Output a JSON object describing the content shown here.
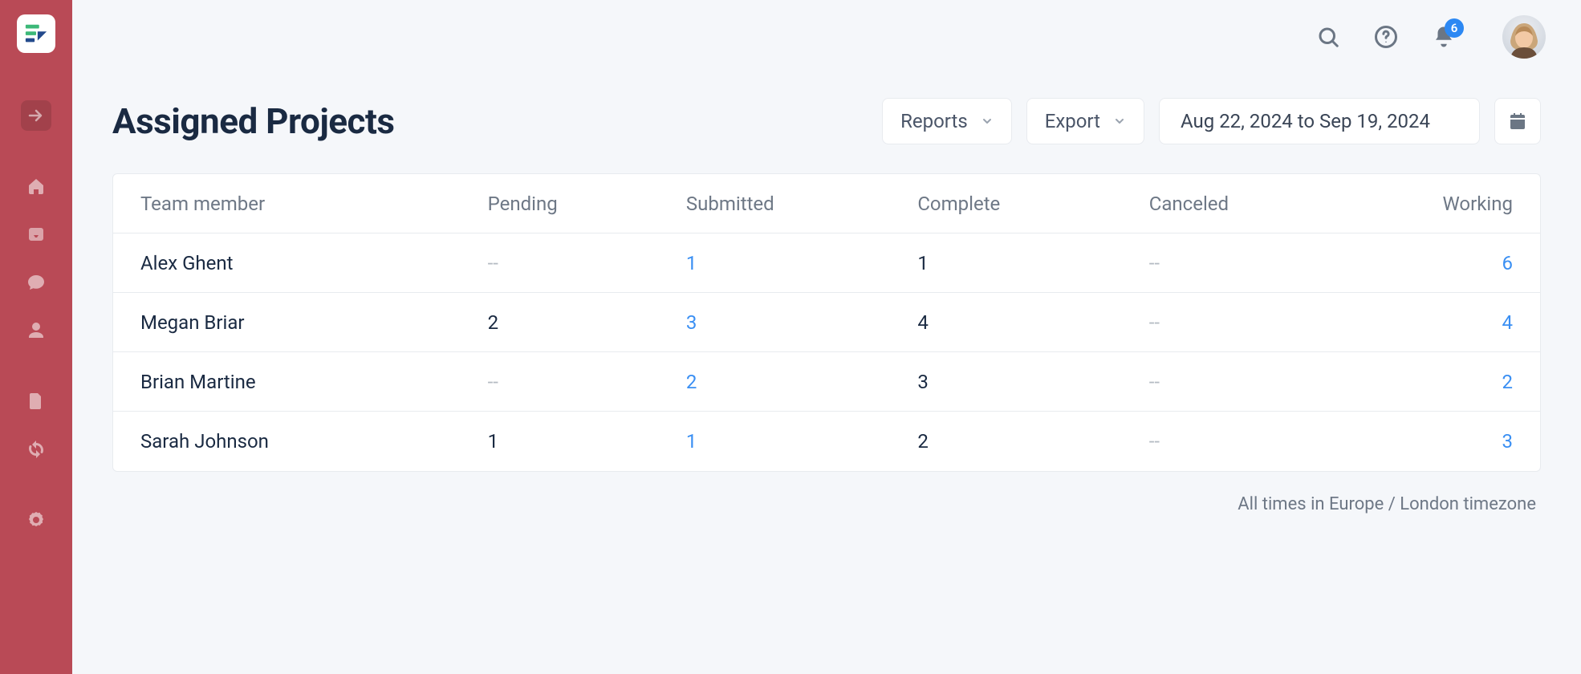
{
  "sidebar": {
    "items": [
      {
        "name": "arrow-right-box-icon"
      },
      {
        "name": "home-icon"
      },
      {
        "name": "inbox-icon"
      },
      {
        "name": "chat-icon"
      },
      {
        "name": "user-icon"
      },
      {
        "name": "document-icon"
      },
      {
        "name": "sync-icon"
      },
      {
        "name": "settings-gear-icon"
      }
    ]
  },
  "topbar": {
    "notification_count": "6"
  },
  "header": {
    "title": "Assigned Projects",
    "reports_label": "Reports",
    "export_label": "Export",
    "date_range": "Aug 22, 2024 to Sep 19, 2024"
  },
  "table": {
    "columns": [
      "Team member",
      "Pending",
      "Submitted",
      "Complete",
      "Canceled",
      "Working"
    ],
    "rows": [
      {
        "member": "Alex Ghent",
        "pending": "--",
        "submitted": "1",
        "complete": "1",
        "canceled": "--",
        "working": "6"
      },
      {
        "member": "Megan Briar",
        "pending": "2",
        "submitted": "3",
        "complete": "4",
        "canceled": "--",
        "working": "4"
      },
      {
        "member": "Brian Martine",
        "pending": "--",
        "submitted": "2",
        "complete": "3",
        "canceled": "--",
        "working": "2"
      },
      {
        "member": "Sarah Johnson",
        "pending": "1",
        "submitted": "1",
        "complete": "2",
        "canceled": "--",
        "working": "3"
      }
    ]
  },
  "footnote": "All times in Europe / London timezone"
}
